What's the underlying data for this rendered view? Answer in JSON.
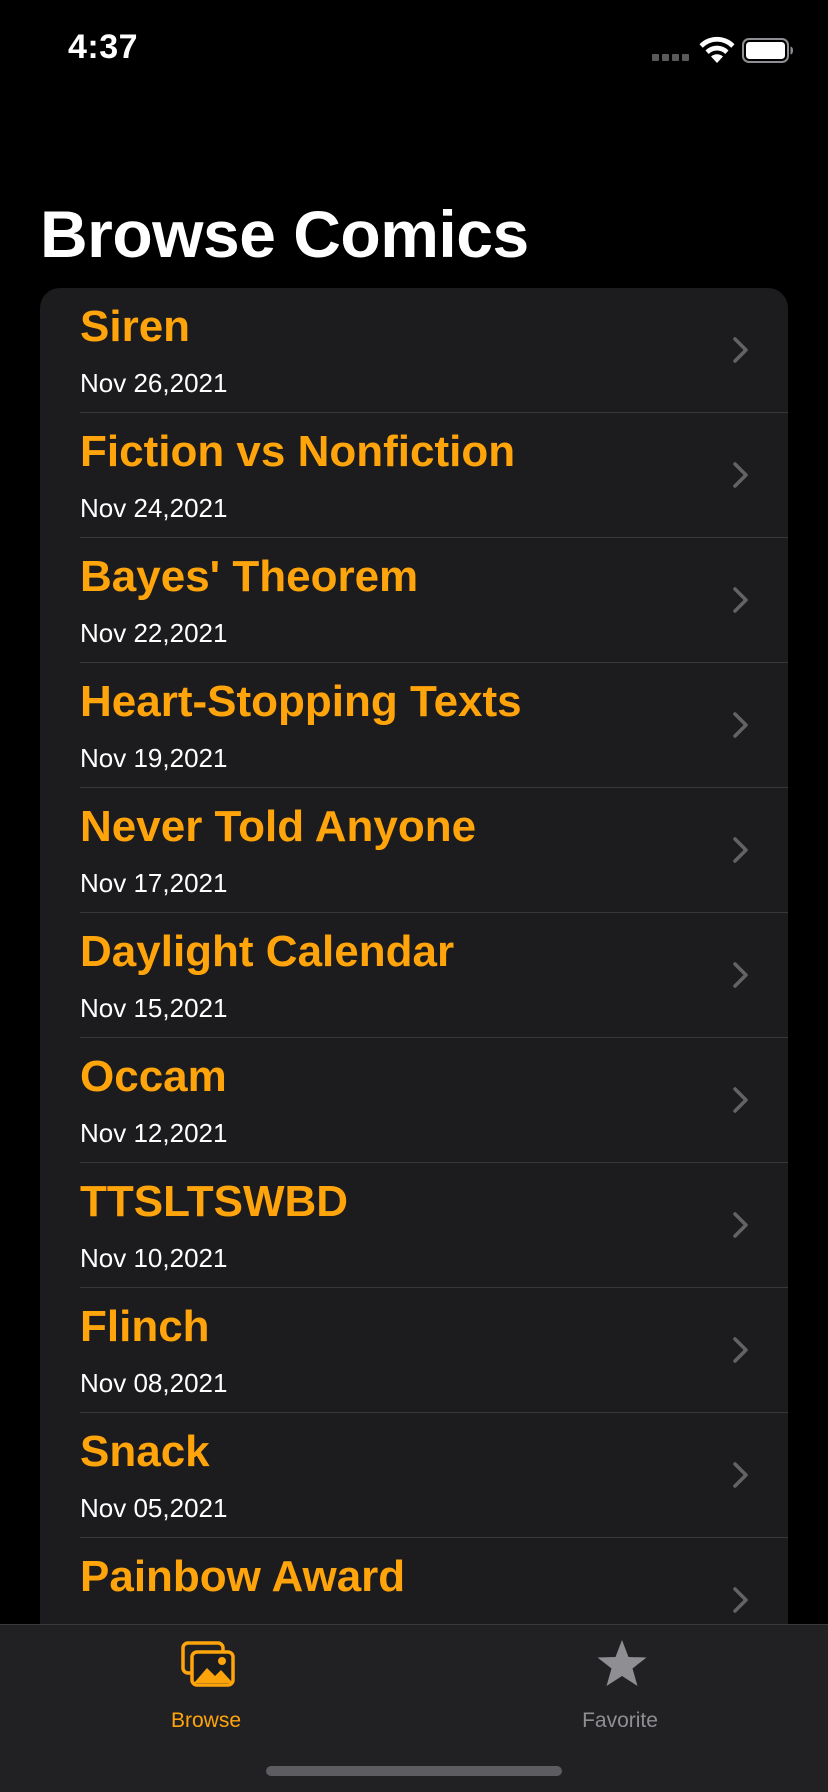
{
  "status_bar": {
    "time": "4:37"
  },
  "page": {
    "title": "Browse Comics"
  },
  "comics": [
    {
      "title": "Siren",
      "date": "Nov 26,2021"
    },
    {
      "title": "Fiction vs Nonfiction",
      "date": "Nov 24,2021"
    },
    {
      "title": "Bayes' Theorem",
      "date": "Nov 22,2021"
    },
    {
      "title": "Heart-Stopping Texts",
      "date": "Nov 19,2021"
    },
    {
      "title": "Never Told Anyone",
      "date": "Nov 17,2021"
    },
    {
      "title": "Daylight Calendar",
      "date": "Nov 15,2021"
    },
    {
      "title": "Occam",
      "date": "Nov 12,2021"
    },
    {
      "title": "TTSLTSWBD",
      "date": "Nov 10,2021"
    },
    {
      "title": "Flinch",
      "date": "Nov 08,2021"
    },
    {
      "title": "Snack",
      "date": "Nov 05,2021"
    },
    {
      "title": "Painbow Award",
      "date": ""
    }
  ],
  "tab_bar": {
    "tabs": [
      {
        "label": "Browse",
        "icon": "photo-stack-icon",
        "selected": true
      },
      {
        "label": "Favorite",
        "icon": "star-icon",
        "selected": false
      }
    ]
  },
  "colors": {
    "accent": "#ffa40b",
    "background": "#000000",
    "list_background": "#1c1c1e",
    "inactive_tab": "#8e8e93"
  }
}
